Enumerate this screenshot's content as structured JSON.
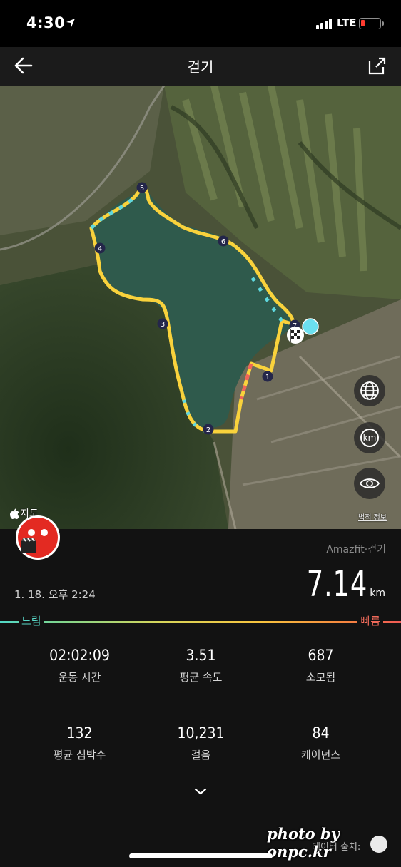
{
  "status_bar": {
    "time": "4:30",
    "network": "LTE",
    "battery_level": 0.1
  },
  "header": {
    "title": "걷기",
    "back_icon": "arrow-left-icon",
    "share_icon": "share-icon"
  },
  "map": {
    "waypoints": [
      "1",
      "2",
      "3",
      "4",
      "5",
      "6",
      "7"
    ],
    "attribution": "지도",
    "legal_link": "법적 정보",
    "buttons": {
      "globe_icon": "globe-icon",
      "km_label": "km",
      "view_icon": "eye-icon"
    },
    "route_color": "#f9d23c",
    "accent_color": "#5fd8df"
  },
  "summary": {
    "source_app": "Amazfit·걷기",
    "date": "1. 18. 오후 2:24",
    "distance_value": "7.14",
    "distance_unit": "km"
  },
  "speed_legend": {
    "slow": "느림",
    "fast": "빠름"
  },
  "stats": [
    {
      "value": "02:02:09",
      "label": "운동 시간"
    },
    {
      "value": "3.51",
      "label": "평균 속도"
    },
    {
      "value": "687",
      "label": "소모됨"
    },
    {
      "value": "132",
      "label": "평균 심박수"
    },
    {
      "value": "10,231",
      "label": "걸음"
    },
    {
      "value": "84",
      "label": "케이던스"
    }
  ],
  "footer": {
    "data_source": "데이터 출처:",
    "watermark": "photo by onpc.kr"
  }
}
